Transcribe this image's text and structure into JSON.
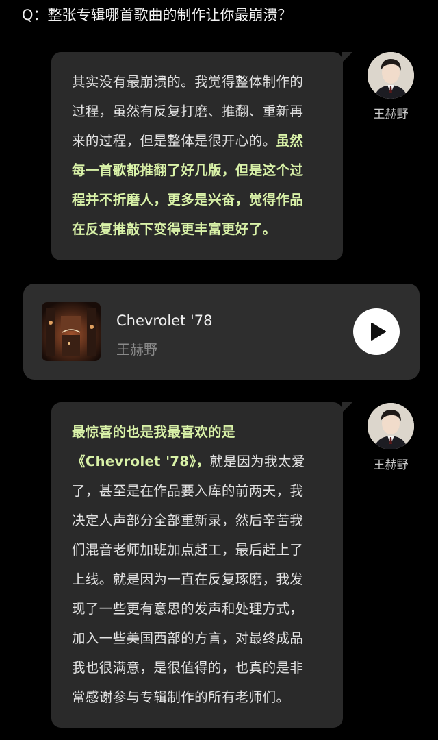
{
  "question": {
    "text": "Q：整张专辑哪首歌曲的制作让你最崩溃？"
  },
  "answers": [
    {
      "speaker": "王赫野",
      "lines": [
        [
          {
            "t": "其实没有最崩溃的。我觉得整体制作的",
            "hl": false
          }
        ],
        [
          {
            "t": "过程，虽然有反复打磨、推翻、重新再",
            "hl": false
          }
        ],
        [
          {
            "t": "来的过程，但是整体是很开心的。",
            "hl": false
          },
          {
            "t": "虽然",
            "hl": true
          }
        ],
        [
          {
            "t": "每一首歌都推翻了好几版，但是这个过",
            "hl": true
          }
        ],
        [
          {
            "t": "程并不折磨人，更多是兴奋，觉得作品",
            "hl": true
          }
        ],
        [
          {
            "t": "在反复推敲下变得更丰富更好了。",
            "hl": true
          }
        ]
      ]
    },
    {
      "speaker": "王赫野",
      "lines": [
        [
          {
            "t": "最惊喜的也是我最喜欢的是",
            "hl": true
          }
        ],
        [
          {
            "t": "《Chevrolet '78》，",
            "hl": true
          },
          {
            "t": "就是因为我太爱",
            "hl": false
          }
        ],
        [
          {
            "t": "了，甚至是在作品要入库的前两天，我",
            "hl": false
          }
        ],
        [
          {
            "t": "决定人声部分全部重新录，然后辛苦我",
            "hl": false
          }
        ],
        [
          {
            "t": "们混音老师加班加点赶工，最后赶上了",
            "hl": false
          }
        ],
        [
          {
            "t": "上线。就是因为一直在反复琢磨，我发",
            "hl": false
          }
        ],
        [
          {
            "t": "现了一些更有意思的发声和处理方式，",
            "hl": false
          }
        ],
        [
          {
            "t": "加入一些美国西部的方言，对最终成品",
            "hl": false
          }
        ],
        [
          {
            "t": "我也很满意，是很值得的，也真的是非",
            "hl": false
          }
        ],
        [
          {
            "t": "常感谢参与专辑制作的所有老师们。",
            "hl": false
          }
        ]
      ]
    }
  ],
  "music_card": {
    "title": "Chevrolet '78",
    "artist": "王赫野",
    "play_icon": "play-icon"
  },
  "colors": {
    "background": "#000000",
    "bubble": "#2a2a2a",
    "highlight": "#d9f2a8",
    "card": "#2e2e2e"
  }
}
